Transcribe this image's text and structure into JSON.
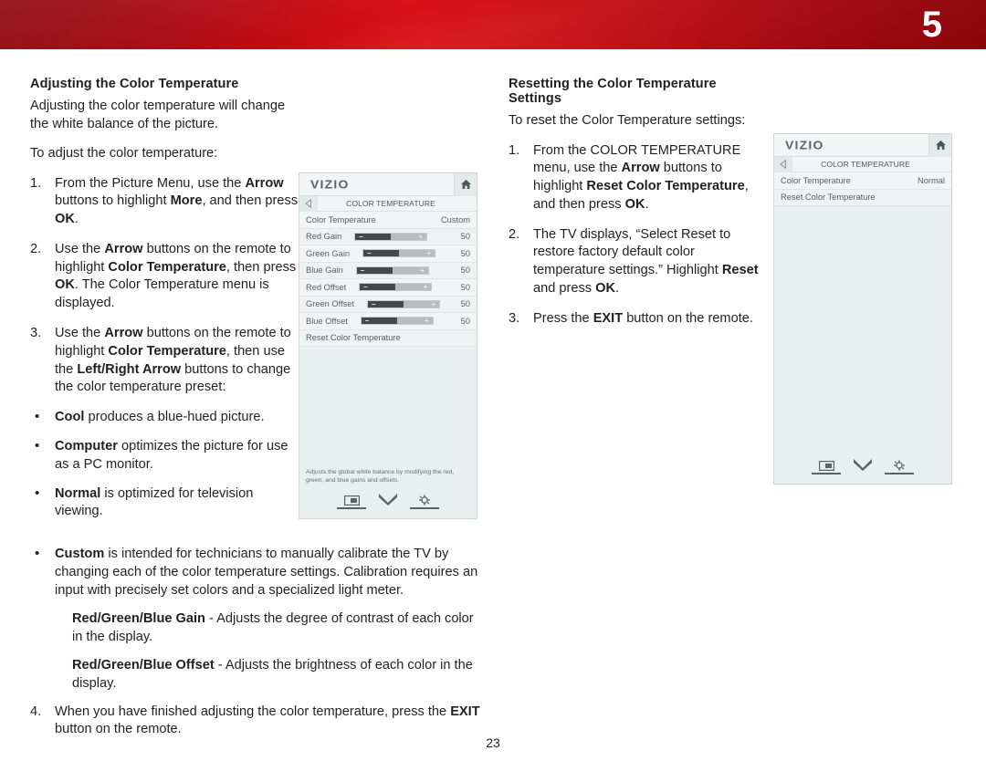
{
  "header": {
    "chapter_number": "5",
    "band_color_left": "#8e0409",
    "band_color_mid": "#d81016",
    "band_color_right": "#93040a"
  },
  "page": {
    "number": "23"
  },
  "left_column": {
    "title": "Adjusting the Color Temperature",
    "intro1": "Adjusting the color temperature will change the white balance of the picture.",
    "intro2": "To adjust the color temperature:",
    "steps": [
      {
        "num": "1.",
        "parts": [
          {
            "t": "From the Picture Menu, use the ",
            "b": false
          },
          {
            "t": "Arrow",
            "b": true
          },
          {
            "t": " buttons to highlight ",
            "b": false
          },
          {
            "t": "More",
            "b": true
          },
          {
            "t": ", and then press ",
            "b": false
          },
          {
            "t": "OK",
            "b": true
          },
          {
            "t": ".",
            "b": false
          }
        ]
      },
      {
        "num": "2.",
        "parts": [
          {
            "t": "Use the ",
            "b": false
          },
          {
            "t": "Arrow",
            "b": true
          },
          {
            "t": " buttons on the remote to highlight ",
            "b": false
          },
          {
            "t": "Color Temperature",
            "b": true
          },
          {
            "t": ", then press ",
            "b": false
          },
          {
            "t": "OK",
            "b": true
          },
          {
            "t": ". The Color Temperature menu is displayed.",
            "b": false
          }
        ]
      },
      {
        "num": "3.",
        "parts": [
          {
            "t": "Use the ",
            "b": false
          },
          {
            "t": "Arrow",
            "b": true
          },
          {
            "t": " buttons on the remote to highlight ",
            "b": false
          },
          {
            "t": "Color Temperature",
            "b": true
          },
          {
            "t": ", then use the ",
            "b": false
          },
          {
            "t": "Left/Right Arrow",
            "b": true
          },
          {
            "t": " buttons to change the color temperature preset:",
            "b": false
          }
        ]
      }
    ],
    "bullets": [
      [
        {
          "t": "Cool",
          "b": true
        },
        {
          "t": " produces a blue-hued picture.",
          "b": false
        }
      ],
      [
        {
          "t": "Computer",
          "b": true
        },
        {
          "t": " optimizes the picture for use as a PC monitor.",
          "b": false
        }
      ],
      [
        {
          "t": "Normal",
          "b": true
        },
        {
          "t": " is optimized for television viewing.",
          "b": false
        }
      ]
    ],
    "bullet_wide": [
      {
        "t": "Custom",
        "b": true
      },
      {
        "t": " is intended for technicians to manually calibrate the TV by changing each of the color temperature settings. Calibration requires an input with precisely set colors and a specialized light meter.",
        "b": false
      }
    ],
    "sub_paragraphs": [
      [
        {
          "t": "Red/Green/Blue Gain",
          "b": true
        },
        {
          "t": " - Adjusts the degree of contrast of each color in the display.",
          "b": false
        }
      ],
      [
        {
          "t": "Red/Green/Blue Offset",
          "b": true
        },
        {
          "t": " - Adjusts the brightness of each color in the display.",
          "b": false
        }
      ]
    ],
    "final_step": {
      "num": "4.",
      "parts": [
        {
          "t": "When you have finished adjusting the color temperature, press the ",
          "b": false
        },
        {
          "t": "EXIT",
          "b": true
        },
        {
          "t": " button on the remote.",
          "b": false
        }
      ]
    }
  },
  "right_column": {
    "title": "Resetting the Color Temperature Settings",
    "intro": "To reset the Color Temperature settings:",
    "steps": [
      {
        "num": "1.",
        "parts": [
          {
            "t": "From the COLOR TEMPERATURE menu, use the ",
            "b": false
          },
          {
            "t": "Arrow",
            "b": true
          },
          {
            "t": " buttons to highlight ",
            "b": false
          },
          {
            "t": "Reset Color Temperature",
            "b": true
          },
          {
            "t": ", and then press ",
            "b": false
          },
          {
            "t": "OK",
            "b": true
          },
          {
            "t": ".",
            "b": false
          }
        ]
      },
      {
        "num": "2.",
        "parts": [
          {
            "t": "The TV displays, “Select Reset to restore factory default color temperature settings.” Highlight ",
            "b": false
          },
          {
            "t": "Reset",
            "b": true
          },
          {
            "t": " and press ",
            "b": false
          },
          {
            "t": "OK",
            "b": true
          },
          {
            "t": ".",
            "b": false
          }
        ]
      },
      {
        "num": "3.",
        "parts": [
          {
            "t": "Press the ",
            "b": false
          },
          {
            "t": "EXIT",
            "b": true
          },
          {
            "t": " button on the remote.",
            "b": false
          }
        ]
      }
    ]
  },
  "osd_custom": {
    "brand": "VIZIO",
    "home_icon": "home-icon",
    "back_icon": "back-arrow-icon",
    "menu_title": "COLOR TEMPERATURE",
    "rows": [
      {
        "label": "Color Temperature",
        "value": "Custom",
        "type": "value"
      },
      {
        "label": "Red Gain",
        "value": "50",
        "type": "slider",
        "fill_pct": 50
      },
      {
        "label": "Green Gain",
        "value": "50",
        "type": "slider",
        "fill_pct": 50
      },
      {
        "label": "Blue Gain",
        "value": "50",
        "type": "slider",
        "fill_pct": 50
      },
      {
        "label": "Red Offset",
        "value": "50",
        "type": "slider",
        "fill_pct": 50
      },
      {
        "label": "Green Offset",
        "value": "50",
        "type": "slider",
        "fill_pct": 50
      },
      {
        "label": "Blue Offset",
        "value": "50",
        "type": "slider",
        "fill_pct": 50
      },
      {
        "label": "Reset Color Temperature",
        "value": "",
        "type": "action"
      }
    ],
    "slider_minus": "–",
    "slider_plus": "+",
    "help_text": "Adjusts the global white balance by modifying the red, green, and blue gains and offsets.",
    "footer_icons": [
      "picture-icon",
      "chevron-down-icon",
      "gear-icon"
    ]
  },
  "osd_normal": {
    "brand": "VIZIO",
    "home_icon": "home-icon",
    "back_icon": "back-arrow-icon",
    "menu_title": "COLOR TEMPERATURE",
    "rows": [
      {
        "label": "Color Temperature",
        "value": "Normal",
        "type": "value"
      },
      {
        "label": "Reset Color Temperature",
        "value": "",
        "type": "action"
      }
    ],
    "help_text": "",
    "footer_icons": [
      "picture-icon",
      "chevron-down-icon",
      "gear-icon"
    ]
  }
}
